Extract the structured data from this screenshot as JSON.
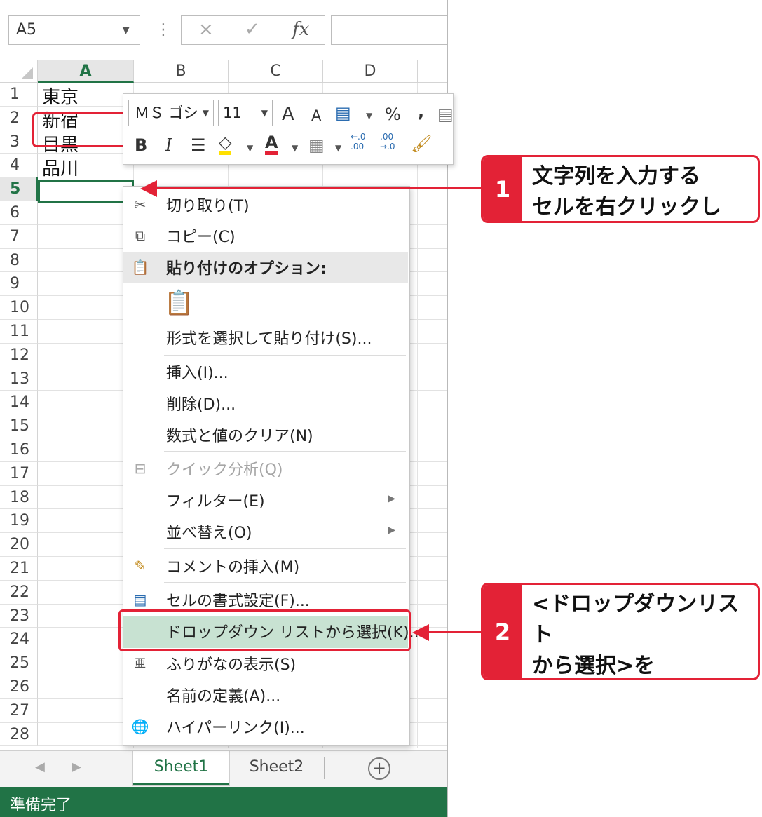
{
  "formula_bar": {
    "name_box": "A5",
    "cancel_icon": "×",
    "enter_icon": "✓",
    "fx_label": "fx"
  },
  "columns": [
    "A",
    "B",
    "C",
    "D"
  ],
  "rows": [
    "1",
    "2",
    "3",
    "4",
    "5",
    "6",
    "7",
    "8",
    "9",
    "10",
    "11",
    "12",
    "13",
    "14",
    "15",
    "16",
    "17",
    "18",
    "19",
    "20",
    "21",
    "22",
    "23",
    "24",
    "25",
    "26",
    "27",
    "28"
  ],
  "cells": {
    "A1": "東京",
    "A2": "新宿",
    "A3": "目黒",
    "A4": "品川"
  },
  "selected_cell": "A5",
  "mini_toolbar": {
    "font": "ＭＳ ゴシ",
    "size": "11",
    "grow_font": "A",
    "shrink_font": "A",
    "percent": "%",
    "comma": ",",
    "bold": "B",
    "italic": "I",
    "font_color": "A",
    "inc_decimal": "←.0\n.00",
    "dec_decimal": ".00\n→.0"
  },
  "context_menu": {
    "cut": "切り取り(T)",
    "copy": "コピー(C)",
    "paste_options": "貼り付けのオプション:",
    "paste_special": "形式を選択して貼り付け(S)...",
    "insert": "挿入(I)...",
    "delete": "削除(D)...",
    "clear_contents": "数式と値のクリア(N)",
    "quick_analysis": "クイック分析(Q)",
    "filter": "フィルター(E)",
    "sort": "並べ替え(O)",
    "insert_comment": "コメントの挿入(M)",
    "format_cells": "セルの書式設定(F)...",
    "pick_from_dropdown": "ドロップダウン リストから選択(K)...",
    "phonetic": "ふりがなの表示(S)",
    "define_name": "名前の定義(A)...",
    "hyperlink": "ハイパーリンク(I)..."
  },
  "sheet_tabs": [
    "Sheet1",
    "Sheet2"
  ],
  "add_sheet": "+",
  "status": "準備完了",
  "callouts": [
    {
      "num": "1",
      "text": "文字列を入力する\nセルを右クリックして、"
    },
    {
      "num": "2",
      "text": "<ドロップダウンリスト\nから選択>を\nクリックすると、"
    }
  ],
  "colors": {
    "excel_green": "#217346",
    "annotation_red": "#e32236",
    "highlight": "#c8e2d2"
  }
}
